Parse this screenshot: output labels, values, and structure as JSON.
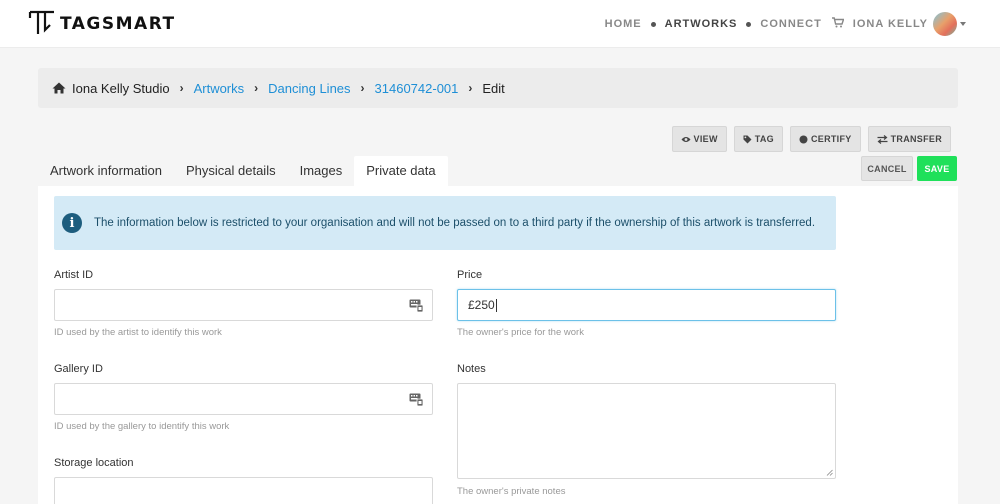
{
  "header": {
    "brand": "TAGSMART",
    "nav": [
      {
        "label": "HOME",
        "active": false
      },
      {
        "label": "ARTWORKS",
        "active": true
      },
      {
        "label": "CONNECT",
        "active": false
      }
    ],
    "user_name": "IONA KELLY"
  },
  "breadcrumb": {
    "home": "Iona Kelly Studio",
    "items": [
      "Artworks",
      "Dancing Lines",
      "31460742-001"
    ],
    "current": "Edit"
  },
  "actions": {
    "view": "VIEW",
    "tag": "TAG",
    "certify": "CERTIFY",
    "transfer": "TRANSFER",
    "cancel": "CANCEL",
    "save": "SAVE"
  },
  "tabs": [
    "Artwork information",
    "Physical details",
    "Images",
    "Private data"
  ],
  "alert": {
    "text": "The information below is restricted to your organisation and will not be passed on to a third party if the ownership of this artwork is transferred."
  },
  "form": {
    "artist_id": {
      "label": "Artist ID",
      "value": "",
      "help": "ID used by the artist to identify this work"
    },
    "gallery_id": {
      "label": "Gallery ID",
      "value": "",
      "help": "ID used by the gallery to identify this work"
    },
    "storage_location": {
      "label": "Storage location",
      "value": ""
    },
    "price": {
      "label": "Price",
      "value": "£250",
      "help": "The owner's price for the work"
    },
    "notes": {
      "label": "Notes",
      "value": "",
      "help": "The owner's private notes"
    }
  },
  "colors": {
    "link": "#1e8fd6",
    "save": "#1fe05a",
    "alert_bg": "#d4eaf6",
    "focus_border": "#6cc1e8"
  }
}
